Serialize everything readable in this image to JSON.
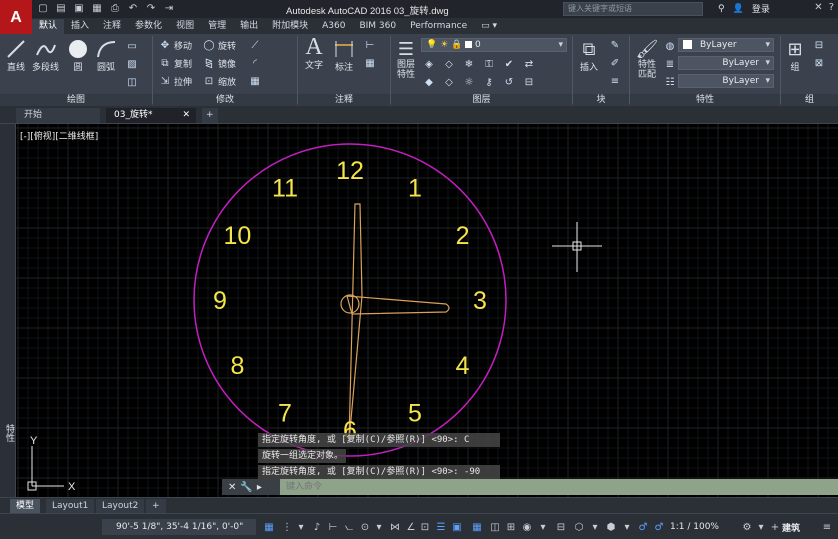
{
  "app": {
    "logo_letter": "A",
    "title": "Autodesk AutoCAD 2016    03_旋转.dwg",
    "search_placeholder": "键入关键字或短语",
    "login_label": "登录"
  },
  "ribbon_tabs": [
    "默认",
    "插入",
    "注释",
    "参数化",
    "视图",
    "管理",
    "输出",
    "附加模块",
    "A360",
    "BIM 360",
    "Performance"
  ],
  "ribbon_tabs_active": 0,
  "groups": {
    "draw": {
      "label": "绘图",
      "line": "直线",
      "polyline": "多段线",
      "circle": "圆",
      "arc": "圆弧"
    },
    "modify": {
      "label": "修改",
      "move": "移动",
      "rotate": "旋转",
      "copy": "复制",
      "mirror": "镜像",
      "stretch": "拉伸",
      "scale": "缩放"
    },
    "annotation": {
      "label": "注释",
      "text": "文字",
      "dimension": "标注"
    },
    "layers": {
      "label": "图层",
      "props": "图层特性",
      "layer_value": "0"
    },
    "block": {
      "label": "块",
      "insert": "插入"
    },
    "properties": {
      "label": "特性",
      "match": "特性匹配",
      "color": "ByLayer",
      "linetype": "ByLayer",
      "lineweight": "ByLayer"
    },
    "group": {
      "label": "组",
      "name": "组"
    }
  },
  "doc_tabs": [
    "开始",
    "03_旋转*"
  ],
  "viewport": {
    "label": "[-][俯视][二维线框]",
    "clock_numbers": [
      "12",
      "1",
      "2",
      "3",
      "4",
      "5",
      "6",
      "7",
      "8",
      "9",
      "10",
      "11"
    ],
    "clock_color": "#f5e44a",
    "circle_color": "#c21fc0",
    "hands_color": "#d9a25a",
    "ucs_x": "X",
    "ucs_y": "Y"
  },
  "left_panel_label": "特性",
  "command_history": [
    "指定旋转角度, 或 [复制(C)/参照(R)] <90>:  C",
    "旋转一组选定对象。",
    "指定旋转角度, 或 [复制(C)/参照(R)] <90>:  -90"
  ],
  "command_placeholder": "键入命令",
  "layout_tabs": [
    "模型",
    "Layout1",
    "Layout2"
  ],
  "status": {
    "coords": "90'-5 1/8\", 35'-4 1/16\", 0'-0\"",
    "scale": "1:1 / 100%",
    "mode": "建筑"
  }
}
